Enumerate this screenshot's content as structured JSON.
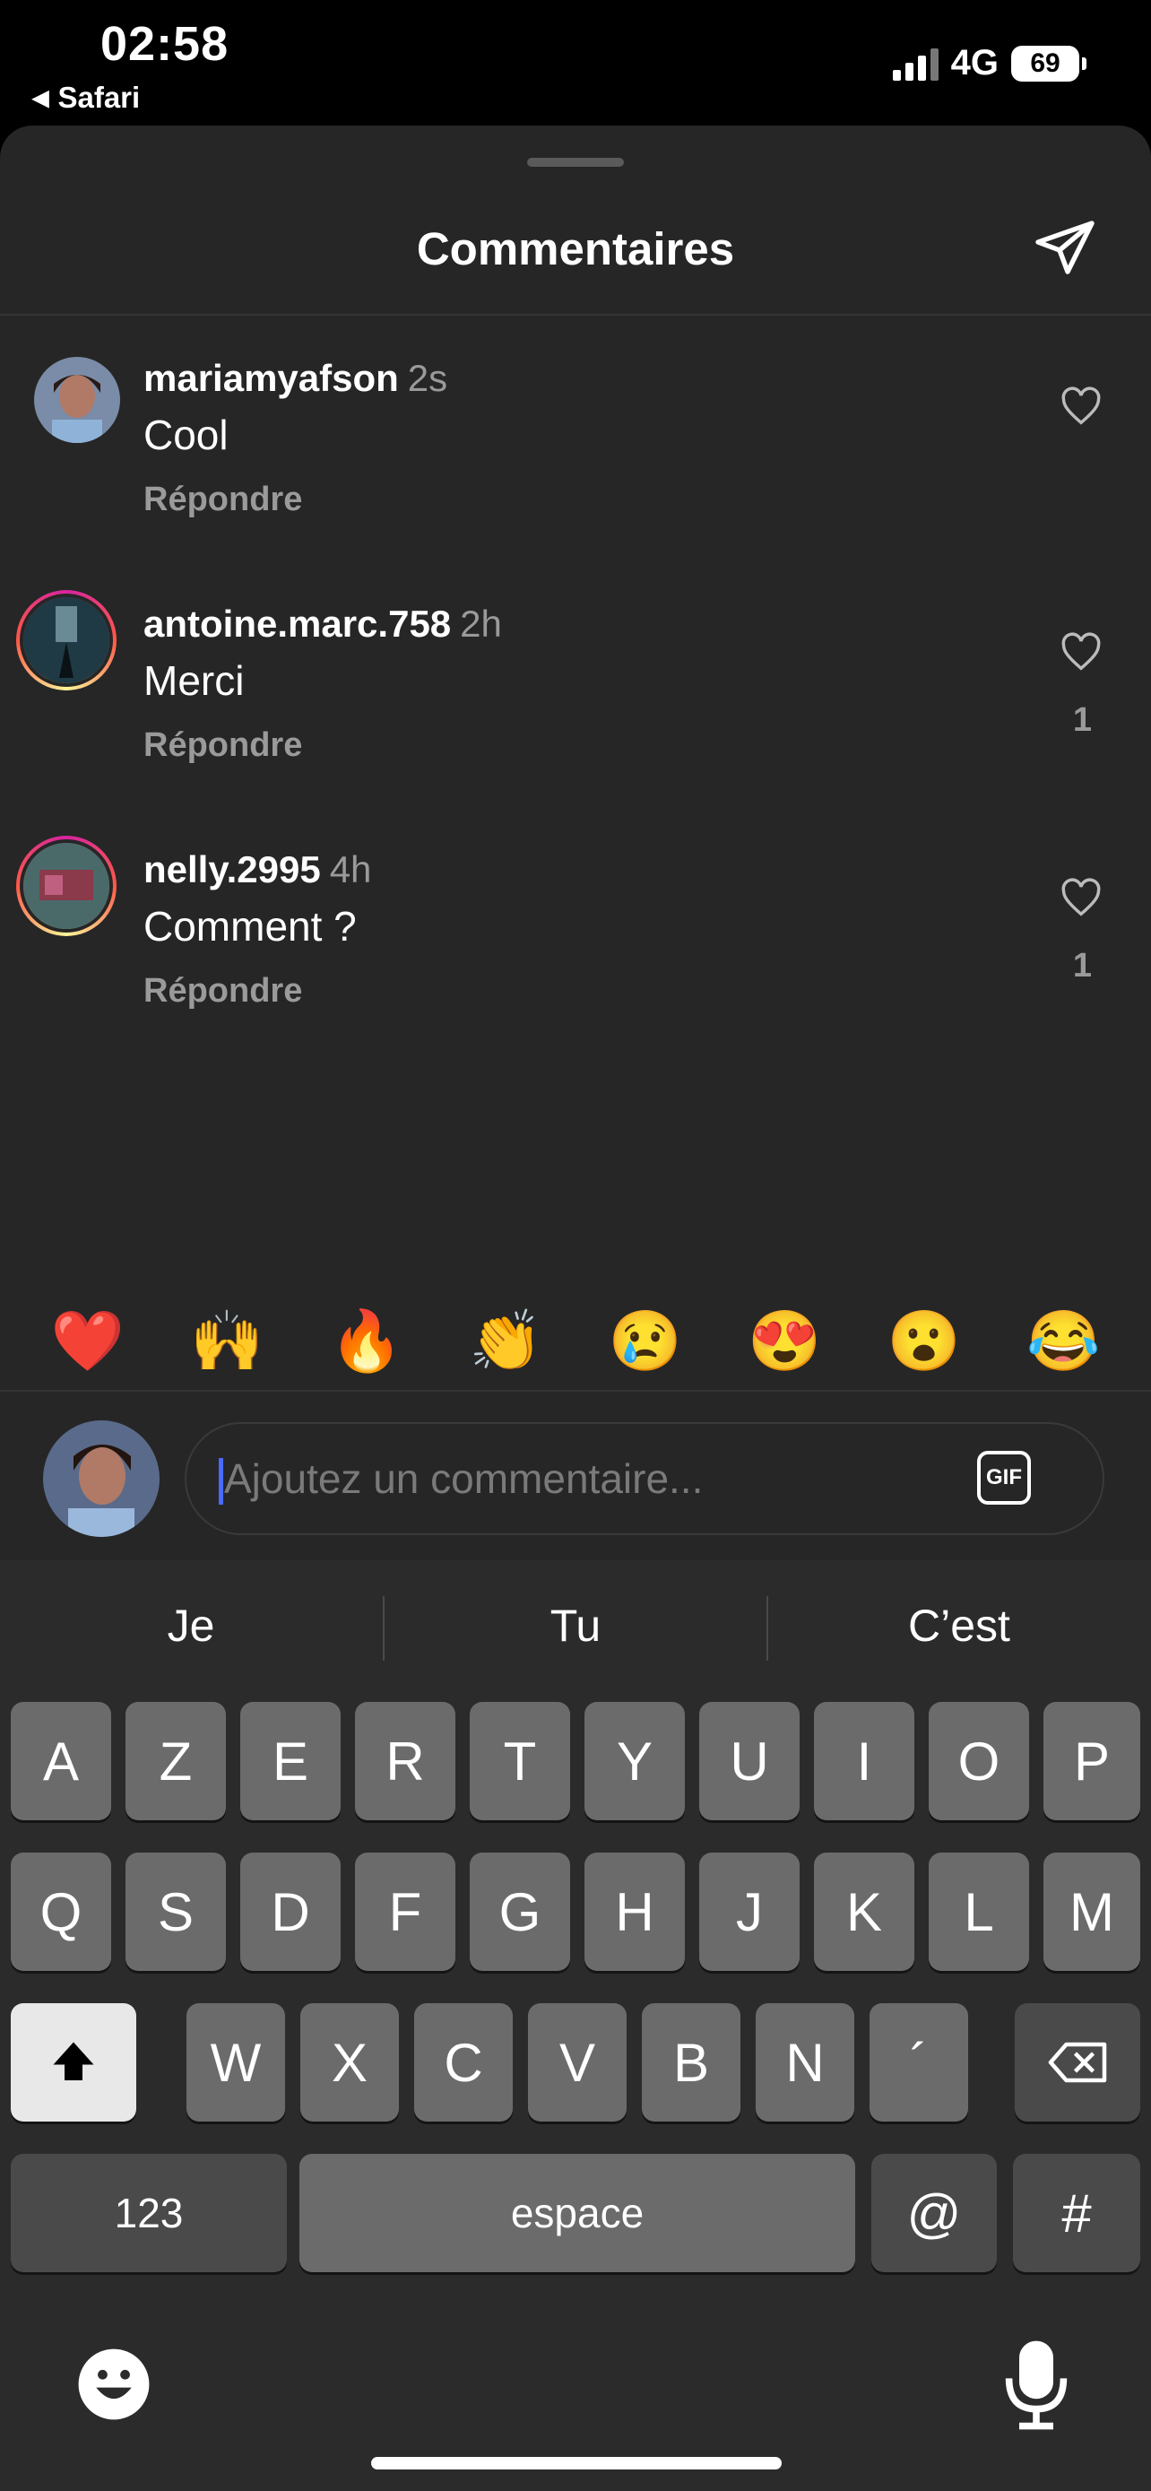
{
  "status_bar": {
    "time": "02:58",
    "back_app": "Safari",
    "network": "4G",
    "battery": "69"
  },
  "sheet": {
    "title": "Commentaires"
  },
  "comments": [
    {
      "username": "mariamyafson",
      "time": "2s",
      "text": "Cool",
      "reply": "Répondre",
      "likes": ""
    },
    {
      "username": "antoine.marc.758",
      "time": "2h",
      "text": "Merci",
      "reply": "Répondre",
      "likes": "1"
    },
    {
      "username": "nelly.2995",
      "time": "4h",
      "text": "Comment ?",
      "reply": "Répondre",
      "likes": "1"
    }
  ],
  "emojis": [
    "❤️",
    "🙌",
    "🔥",
    "👏",
    "😢",
    "😍",
    "😮",
    "😂"
  ],
  "input": {
    "placeholder": "Ajoutez un commentaire...",
    "gif_label": "GIF"
  },
  "keyboard": {
    "suggestions": [
      "Je",
      "Tu",
      "C’est"
    ],
    "row1": [
      "A",
      "Z",
      "E",
      "R",
      "T",
      "Y",
      "U",
      "I",
      "O",
      "P"
    ],
    "row2": [
      "Q",
      "S",
      "D",
      "F",
      "G",
      "H",
      "J",
      "K",
      "L",
      "M"
    ],
    "row3": [
      "W",
      "X",
      "C",
      "V",
      "B",
      "N",
      "´"
    ],
    "numbers_key": "123",
    "space_key": "espace",
    "at_key": "@",
    "hash_key": "#"
  },
  "colors": {
    "sheet_bg": "#262626",
    "keyboard_bg": "#2b2b2b",
    "key_bg": "#6b6b6b",
    "secondary_text": "#9a9a9a"
  }
}
